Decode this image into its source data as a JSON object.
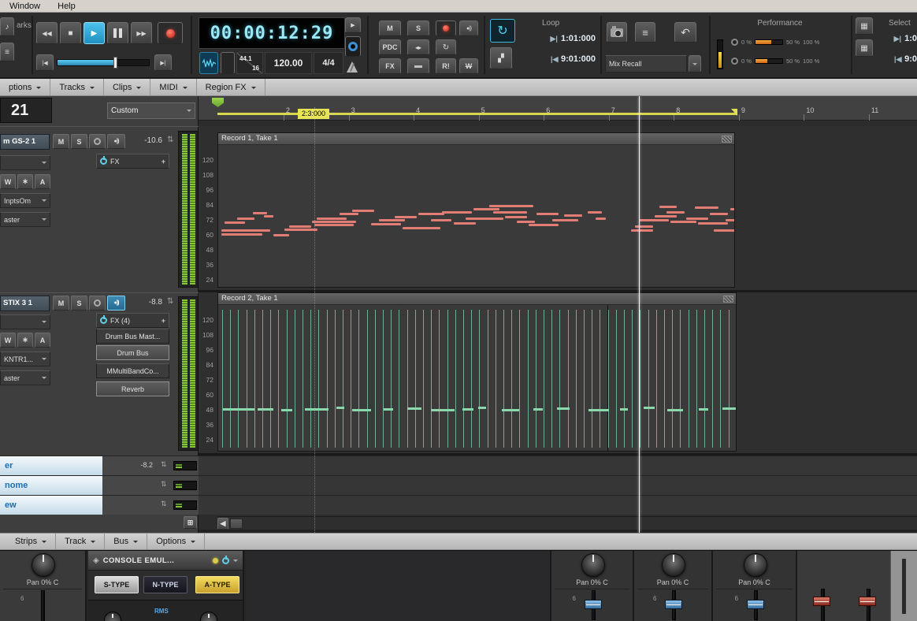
{
  "menubar": {
    "items": [
      "Window",
      "Help"
    ]
  },
  "left_module": {
    "label": "arks"
  },
  "transport": {
    "time": "00:00:12:29",
    "sample_rate": "44.1",
    "bit_depth": "16",
    "tempo": "120.00",
    "time_sig": "4/4"
  },
  "grid": {
    "m": "M",
    "s": "S",
    "pdc": "PDC",
    "fx": "FX",
    "r": "R!",
    "w": "W"
  },
  "loop": {
    "label": "Loop",
    "start": "1:01:000",
    "end": "9:01:000"
  },
  "mix": {
    "recall": "Mix Recall"
  },
  "perf": {
    "label": "Performance",
    "scale": [
      "0 %",
      "50 %",
      "100 %"
    ]
  },
  "select": {
    "label": "Select",
    "start": "1:0",
    "end": "9:0"
  },
  "tabs": [
    "ptions",
    "Tracks",
    "Clips",
    "MIDI",
    "Region FX"
  ],
  "pane": {
    "big_number": "21",
    "preset": "Custom"
  },
  "ruler": {
    "measures": [
      "2",
      "3",
      "4",
      "5",
      "6",
      "7",
      "8",
      "9",
      "10",
      "11"
    ],
    "now": "2:3:000"
  },
  "ui": {
    "plus": "+",
    "freeze": "∗"
  },
  "tracks": [
    {
      "name": "m GS-2 1",
      "m": "M",
      "s": "S",
      "gain": "-10.6",
      "fx": "FX",
      "w": "W",
      "a": "A",
      "input": "InptsOm",
      "output": "aster"
    },
    {
      "name": "STIX 3 1",
      "m": "M",
      "s": "S",
      "gain": "-8.8",
      "fx": "FX (4)",
      "w": "W",
      "a": "A",
      "input": "KNTR1...",
      "output": "aster",
      "plugins": [
        "Drum Bus Mast...",
        "Drum Bus",
        "MMultiBandCo...",
        "Reverb"
      ]
    }
  ],
  "bottom_tracks": [
    {
      "name": "er",
      "gain": "-8.2"
    },
    {
      "name": "nome",
      "gain": ""
    },
    {
      "name": "ew",
      "gain": ""
    }
  ],
  "clips": [
    {
      "title": "Record 1, Take 1",
      "pitch_labels": [
        "120",
        "108",
        "96",
        "84",
        "72",
        "60",
        "48",
        "36",
        "24"
      ],
      "notes": [
        [
          4,
          107,
          62
        ],
        [
          4,
          112,
          52
        ],
        [
          8,
          97,
          26
        ],
        [
          24,
          92,
          22
        ],
        [
          44,
          85,
          18
        ],
        [
          58,
          89,
          12
        ],
        [
          70,
          113,
          20
        ],
        [
          84,
          106,
          42
        ],
        [
          90,
          102,
          28
        ],
        [
          119,
          96,
          56
        ],
        [
          122,
          100,
          50
        ],
        [
          125,
          92,
          38
        ],
        [
          154,
          86,
          24
        ],
        [
          170,
          82,
          28
        ],
        [
          194,
          99,
          38
        ],
        [
          204,
          94,
          33
        ],
        [
          224,
          90,
          28
        ],
        [
          234,
          104,
          48
        ],
        [
          254,
          86,
          33
        ],
        [
          270,
          94,
          26
        ],
        [
          284,
          84,
          38
        ],
        [
          299,
          98,
          28
        ],
        [
          314,
          92,
          48
        ],
        [
          324,
          80,
          33
        ],
        [
          344,
          76,
          56
        ],
        [
          349,
          84,
          43
        ],
        [
          364,
          90,
          28
        ],
        [
          379,
          96,
          23
        ],
        [
          394,
          100,
          38
        ],
        [
          404,
          86,
          28
        ],
        [
          424,
          94,
          33
        ],
        [
          439,
          88,
          23
        ],
        [
          469,
          84,
          18
        ],
        [
          479,
          92,
          13
        ],
        [
          524,
          107,
          28
        ],
        [
          529,
          102,
          23
        ],
        [
          534,
          94,
          38
        ],
        [
          554,
          89,
          28
        ],
        [
          560,
          77,
          22
        ],
        [
          569,
          84,
          23
        ],
        [
          574,
          96,
          33
        ],
        [
          594,
          92,
          28
        ],
        [
          605,
          78,
          30
        ],
        [
          609,
          98,
          38
        ],
        [
          624,
          86,
          23
        ],
        [
          629,
          107,
          43
        ],
        [
          644,
          94,
          13
        ],
        [
          650,
          80,
          20
        ]
      ]
    },
    {
      "title": "Record 2, Take 1",
      "pitch_labels": [
        "120",
        "108",
        "96",
        "84",
        "72",
        "60",
        "48",
        "36",
        "24"
      ],
      "vlines": {
        "count": 64,
        "start": 5,
        "step": 10.2
      },
      "hnotes": [
        [
          6,
          131,
          40
        ],
        [
          50,
          131,
          20
        ],
        [
          80,
          132,
          14
        ],
        [
          110,
          131,
          30
        ],
        [
          150,
          129,
          10
        ],
        [
          170,
          132,
          24
        ],
        [
          210,
          131,
          12
        ],
        [
          240,
          130,
          18
        ],
        [
          270,
          132,
          30
        ],
        [
          310,
          131,
          14
        ],
        [
          330,
          129,
          10
        ],
        [
          360,
          132,
          22
        ],
        [
          400,
          131,
          12
        ],
        [
          430,
          130,
          16
        ],
        [
          470,
          132,
          26
        ],
        [
          510,
          131,
          10
        ],
        [
          540,
          129,
          14
        ],
        [
          570,
          132,
          20
        ],
        [
          610,
          131,
          12
        ],
        [
          640,
          130,
          18
        ]
      ]
    }
  ],
  "console": {
    "menu": [
      "Strips",
      "Track",
      "Bus",
      "Options"
    ],
    "module_title": "CONSOLE EMUL...",
    "types": [
      "S-TYPE",
      "N-TYPE",
      "A-TYPE"
    ],
    "pan_label": "Pan 0% C",
    "rms": "RMS",
    "tick": "6"
  },
  "icons": {
    "rewind": "◀◀",
    "stop": "■",
    "play": "▶",
    "ffwd": "▶▶",
    "skip_back": "|◀",
    "skip_fwd": "▶|",
    "list": "≡",
    "undo": "↶",
    "loop": "↻",
    "stairs": "▞",
    "grid": "▦",
    "echo": "●))",
    "updown": "⇅",
    "expand": "▶",
    "dim": "◂▸",
    "cycle": "↻",
    "note": "♪"
  }
}
